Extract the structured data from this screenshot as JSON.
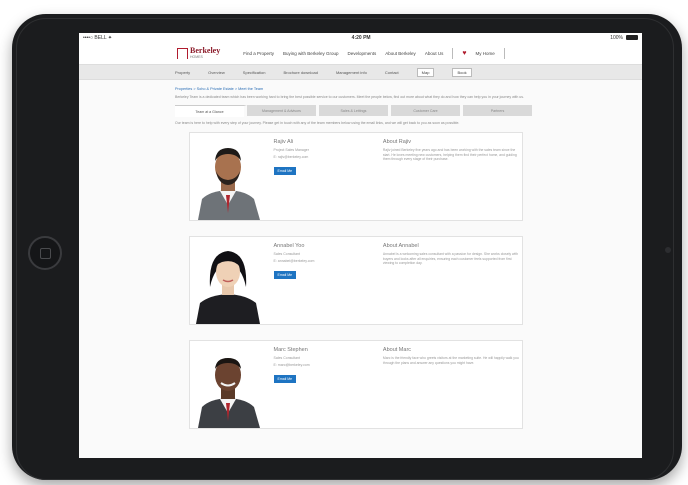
{
  "statusbar": {
    "carrier": "••••○ BELL ✦",
    "time": "4:20 PM",
    "battery": "100%"
  },
  "brand": {
    "name": "Berkeley",
    "sub": "HOMES"
  },
  "topnav": {
    "items": [
      "Find a Property",
      "Buying with Berkeley Group",
      "Developments",
      "About Berkeley",
      "About Us"
    ],
    "icon": "heart-icon",
    "icon_label": "My Home"
  },
  "secondarynav": {
    "items": [
      "Property",
      "Overview",
      "Specification",
      "Brochure download",
      "Management info",
      "Contact"
    ],
    "button": "Map",
    "button2": "Book"
  },
  "breadcrumb": "Properties > Soho & Private Estate > Meet the Team",
  "intro": "Berkeley Team is a dedicated team which has been working hard to bring the best possible service to our customers. Meet the people below, find out more about what they do and how they can help you in your journey with us.",
  "tabs": [
    "Team at a Glance",
    "Management & Advisors",
    "Sales & Lettings",
    "Customer Care",
    "Partners"
  ],
  "tab_note": "Our team is here to help with every step of your journey. Please get in touch with any of the team members below using the email links, and we will get back to you as soon as possible.",
  "profiles": [
    {
      "name": "Rajiv Ali",
      "role": "Project Sales Manager",
      "email": "E: rajiv@berkeley.com",
      "button": "Email Me",
      "about_title": "About Rajiv",
      "about_text": "Rajiv joined Berkeley five years ago and has been working with the sales team since the start. He loves meeting new customers, helping them find their perfect home, and guiding them through every stage of their purchase."
    },
    {
      "name": "Annabel Yoo",
      "role": "Sales Consultant",
      "email": "E: annabel@berkeley.com",
      "button": "Email Me",
      "about_title": "About Annabel",
      "about_text": "Annabel is a welcoming sales consultant with a passion for design. She works closely with buyers and looks after all enquiries, ensuring each customer feels supported from first viewing to completion day."
    },
    {
      "name": "Marc Stephen",
      "role": "Sales Consultant",
      "email": "E: marc@berkeley.com",
      "button": "Email Me",
      "about_title": "About Marc",
      "about_text": "Marc is the friendly face who greets visitors at the marketing suite. He will happily walk you through the plans and answer any questions you might have."
    }
  ],
  "colors": {
    "accent": "#1e74c2",
    "brand": "#8c1c2b",
    "tablet": "#1b1c1e"
  }
}
